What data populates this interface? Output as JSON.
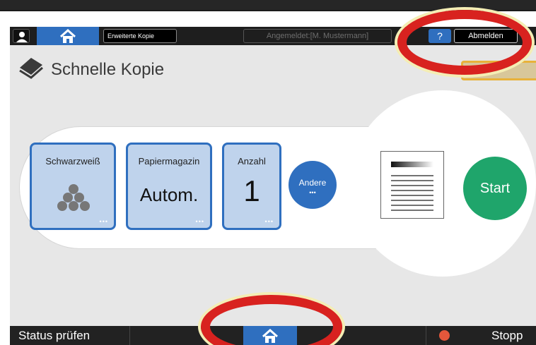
{
  "header": {
    "user_icon": "user-icon",
    "home_icon": "home-icon",
    "mode_label": "Erweiterte Kopie",
    "login_status": "Angemeldet:[M. Mustermann]",
    "help_label": "?",
    "logout_label": "Abmelden"
  },
  "page": {
    "title": "Schnelle Kopie",
    "title_icon": "copy-stack-icon"
  },
  "tiles": [
    {
      "label": "Schwarzweiß",
      "icon": "color-dots-icon",
      "more": "•••"
    },
    {
      "label": "Papiermagazin",
      "value": "Autom.",
      "more": "•••"
    },
    {
      "label": "Anzahl",
      "value": "1",
      "more": "•••"
    }
  ],
  "andere": {
    "label": "Andere",
    "more": "•••"
  },
  "preview_icon": "document-preview-icon",
  "start": {
    "label": "Start"
  },
  "footer": {
    "status_label": "Status prüfen",
    "home_icon": "home-icon",
    "stop_label": "Stopp",
    "stop_icon": "stop-icon"
  },
  "colors": {
    "accent": "#2f6fbf",
    "start": "#1fa56b",
    "highlight": "#d8221f"
  }
}
